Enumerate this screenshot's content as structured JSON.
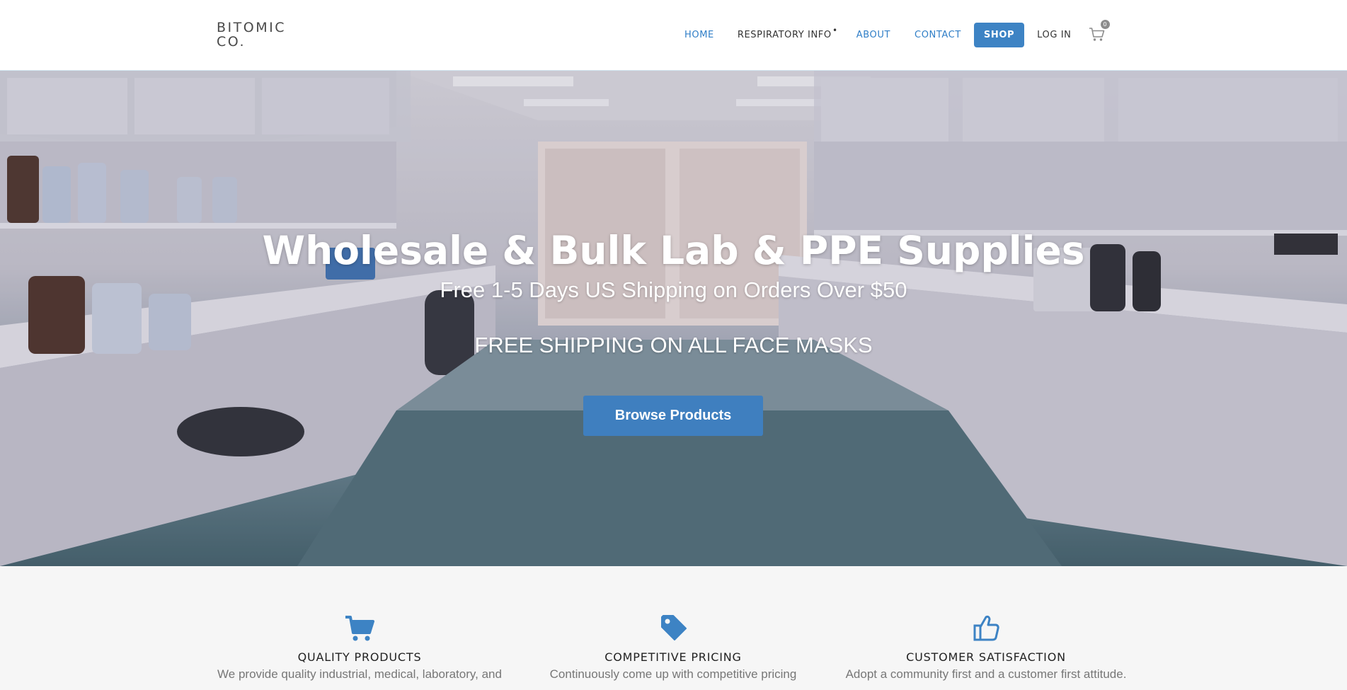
{
  "brand": {
    "line1": "BITOMIC",
    "line2": "CO."
  },
  "nav": {
    "home": "HOME",
    "respiratory": "RESPIRATORY INFO",
    "respiratory_marker": "•",
    "about": "ABOUT",
    "contact": "CONTACT",
    "shop": "SHOP",
    "login": "LOG IN",
    "cart_count": "0"
  },
  "hero": {
    "title": "Wholesale & Bulk Lab & PPE Supplies",
    "subtitle": "Free 1-5 Days US Shipping on Orders Over $50",
    "promo": "FREE SHIPPING ON ALL FACE MASKS",
    "button": "Browse Products"
  },
  "features": [
    {
      "icon": "cart-icon",
      "title": "QUALITY PRODUCTS",
      "desc": "We provide quality industrial, medical, laboratory, and"
    },
    {
      "icon": "tag-icon",
      "title": "COMPETITIVE PRICING",
      "desc": "Continuously come up with competitive pricing"
    },
    {
      "icon": "thumbs-up-icon",
      "title": "CUSTOMER SATISFACTION",
      "desc": "Adopt a community first and a customer first attitude."
    }
  ],
  "colors": {
    "accent": "#3d83c4",
    "nav_link": "#2f7ec7",
    "header_bg": "#ffffff",
    "section_bg": "#f6f6f6"
  }
}
